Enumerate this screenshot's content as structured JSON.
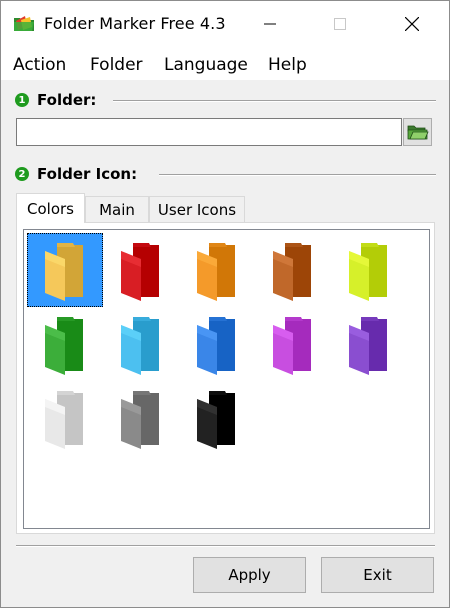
{
  "window": {
    "title": "Folder Marker Free 4.3",
    "controls": [
      "minimize",
      "maximize",
      "close"
    ]
  },
  "menu": {
    "items": [
      {
        "label": "Action"
      },
      {
        "label": "Folder"
      },
      {
        "label": "Language"
      },
      {
        "label": "Help"
      }
    ]
  },
  "folder_section": {
    "step": "1",
    "label": "Folder:",
    "input_value": "",
    "browse_icon": "open-folder-icon"
  },
  "icon_section": {
    "step": "2",
    "label": "Folder Icon:",
    "tabs": [
      {
        "label": "Colors",
        "active": true
      },
      {
        "label": "Main",
        "active": false
      },
      {
        "label": "User Icons",
        "active": false
      }
    ],
    "icons": [
      {
        "name": "default",
        "color": "#f5c85a",
        "selected": true
      },
      {
        "name": "red",
        "color": "#d81e24",
        "selected": false
      },
      {
        "name": "orange",
        "color": "#f49a2a",
        "selected": false
      },
      {
        "name": "brown",
        "color": "#c0682a",
        "selected": false
      },
      {
        "name": "yellow-green",
        "color": "#d6f02a",
        "selected": false
      },
      {
        "name": "green",
        "color": "#3cae3a",
        "selected": false
      },
      {
        "name": "light-blue",
        "color": "#4cc0f0",
        "selected": false
      },
      {
        "name": "blue",
        "color": "#3a86e8",
        "selected": false
      },
      {
        "name": "pink",
        "color": "#c84ee0",
        "selected": false
      },
      {
        "name": "purple",
        "color": "#8a4ed0",
        "selected": false
      },
      {
        "name": "white",
        "color": "#e8e8e8",
        "selected": false
      },
      {
        "name": "gray",
        "color": "#8a8a8a",
        "selected": false
      },
      {
        "name": "black",
        "color": "#222222",
        "selected": false
      }
    ]
  },
  "buttons": {
    "apply": "Apply",
    "exit": "Exit"
  }
}
